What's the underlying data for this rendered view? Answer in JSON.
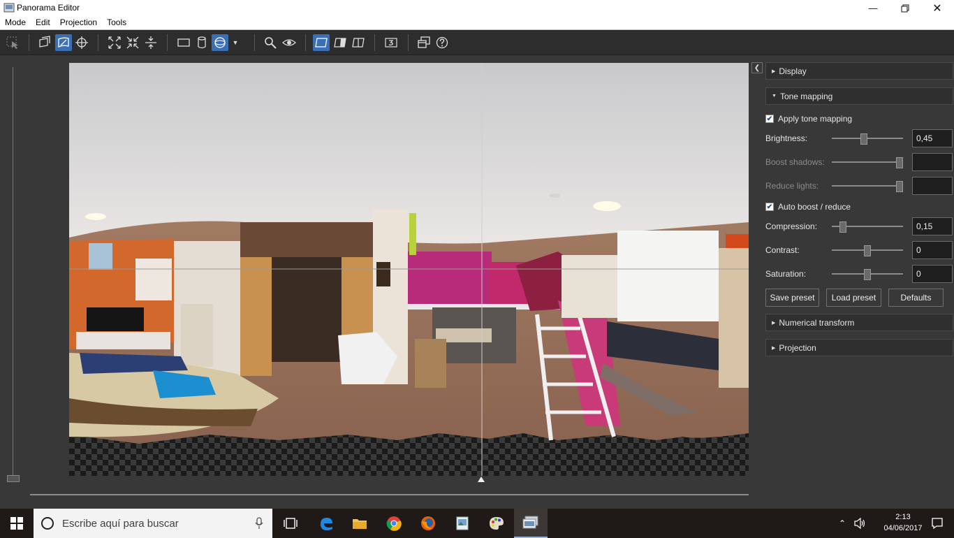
{
  "window": {
    "title": "Panorama Editor"
  },
  "menu": {
    "items": [
      "Mode",
      "Edit",
      "Projection",
      "Tools"
    ]
  },
  "panel": {
    "display": {
      "label": "Display"
    },
    "tone_mapping": {
      "label": "Tone mapping",
      "apply": {
        "label": "Apply tone mapping",
        "checked": true
      },
      "brightness": {
        "label": "Brightness:",
        "value": "0,45",
        "slider": 0.45
      },
      "boost_shadows": {
        "label": "Boost shadows:",
        "value": "",
        "slider": 1.0
      },
      "reduce_lights": {
        "label": "Reduce lights:",
        "value": "",
        "slider": 1.0
      },
      "auto_boost": {
        "label": "Auto boost / reduce",
        "checked": true
      },
      "compression": {
        "label": "Compression:",
        "value": "0,15",
        "slider": 0.15
      },
      "contrast": {
        "label": "Contrast:",
        "value": "0",
        "slider": 0.5
      },
      "saturation": {
        "label": "Saturation:",
        "value": "0",
        "slider": 0.5
      },
      "save_preset": "Save preset",
      "load_preset": "Load preset",
      "defaults": "Defaults"
    },
    "numerical_transform": {
      "label": "Numerical transform"
    },
    "projection": {
      "label": "Projection"
    }
  },
  "taskbar": {
    "search_placeholder": "Escribe aquí para buscar",
    "time": "2:13",
    "date": "04/06/2017"
  }
}
